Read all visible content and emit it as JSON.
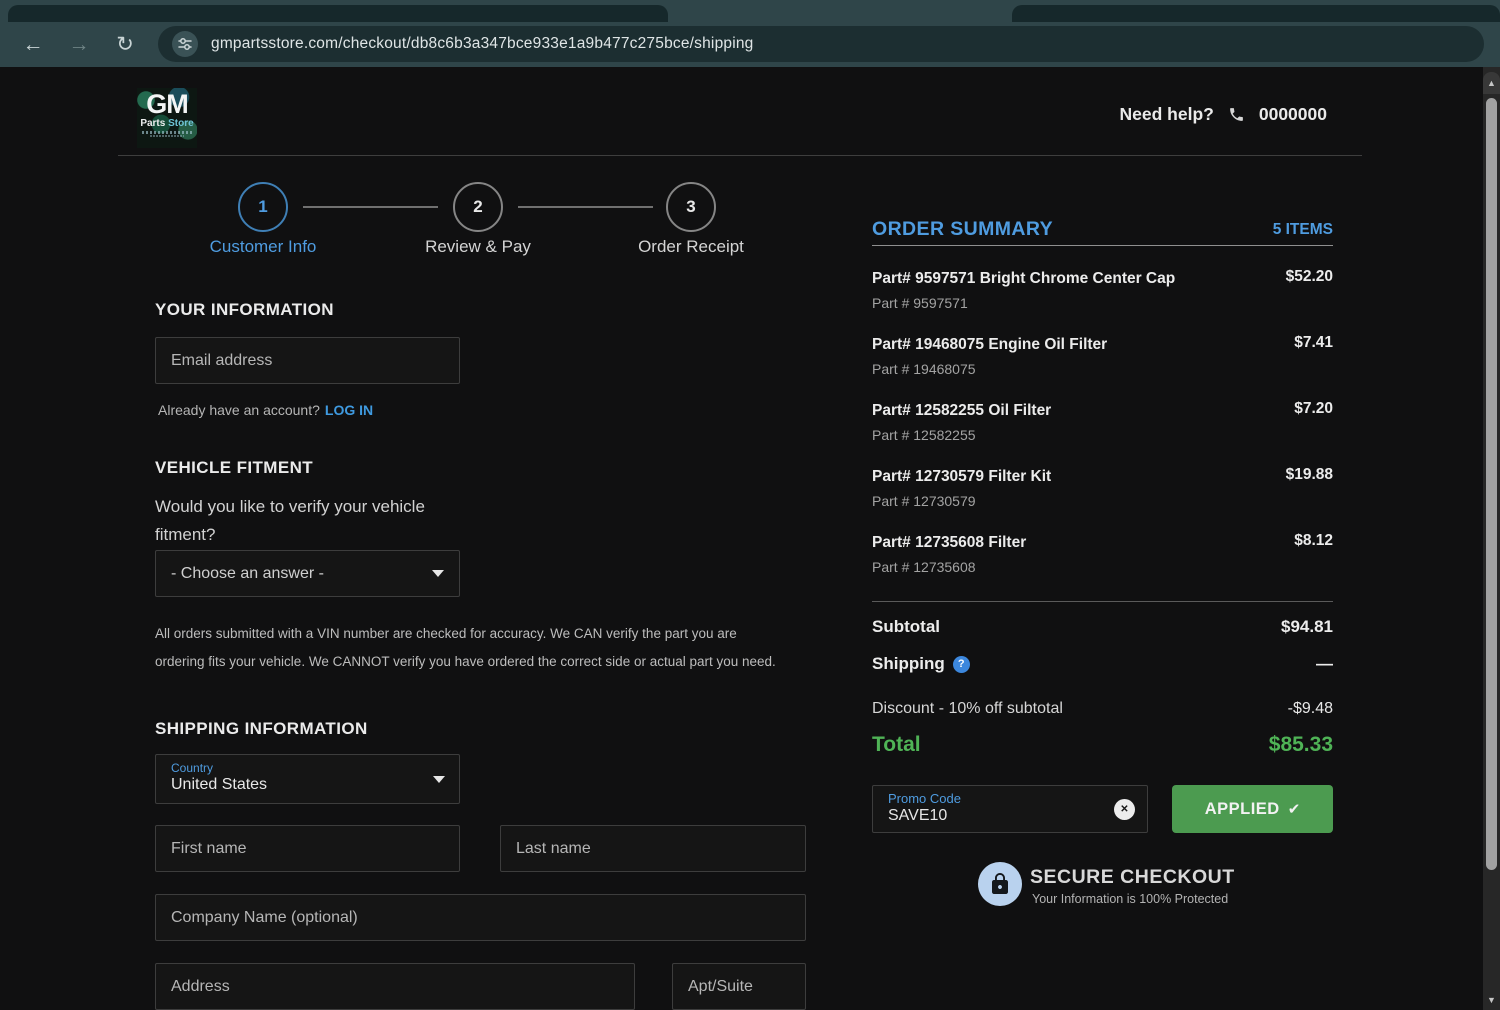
{
  "browser": {
    "url": "gmpartsstore.com/checkout/db8c6b3a347bce933e1a9b477c275bce/shipping"
  },
  "header": {
    "logo_line1": "GM",
    "logo_parts": "Parts",
    "logo_store": "Store",
    "need_help": "Need help?",
    "phone_number": "0000000"
  },
  "stepper": {
    "steps": [
      {
        "number": "1",
        "label": "Customer Info"
      },
      {
        "number": "2",
        "label": "Review & Pay"
      },
      {
        "number": "3",
        "label": "Order Receipt"
      }
    ]
  },
  "your_information": {
    "title": "YOUR INFORMATION",
    "email_placeholder": "Email address",
    "account_prompt": "Already have an account?",
    "login_link": "LOG IN"
  },
  "vehicle_fitment": {
    "title": "VEHICLE FITMENT",
    "question": "Would you like to verify your vehicle fitment?",
    "select_value": "- Choose an answer -",
    "disclaimer": "All orders submitted with a VIN number are checked for accuracy. We CAN verify the part you are ordering fits your vehicle. We CANNOT verify you have ordered the correct side or actual part you need."
  },
  "shipping_information": {
    "title": "SHIPPING INFORMATION",
    "country_label": "Country",
    "country_value": "United States",
    "first_name_placeholder": "First name",
    "last_name_placeholder": "Last name",
    "company_placeholder": "Company Name (optional)",
    "address_placeholder": "Address",
    "apt_placeholder": "Apt/Suite"
  },
  "order_summary": {
    "title": "ORDER SUMMARY",
    "items_count": "5 ITEMS",
    "items": [
      {
        "title": "Part# 9597571 Bright Chrome Center Cap",
        "subtitle": "Part # 9597571",
        "price": "$52.20"
      },
      {
        "title": "Part# 19468075 Engine Oil Filter",
        "subtitle": "Part # 19468075",
        "price": "$7.41"
      },
      {
        "title": "Part# 12582255 Oil Filter",
        "subtitle": "Part # 12582255",
        "price": "$7.20"
      },
      {
        "title": "Part# 12730579 Filter Kit",
        "subtitle": "Part # 12730579",
        "price": "$19.88"
      },
      {
        "title": "Part# 12735608 Filter",
        "subtitle": "Part # 12735608",
        "price": "$8.12"
      }
    ],
    "totals": {
      "subtotal_label": "Subtotal",
      "subtotal_value": "$94.81",
      "shipping_label": "Shipping",
      "shipping_value": "—",
      "discount_label": "Discount - 10% off subtotal",
      "discount_value": "-$9.48",
      "total_label": "Total",
      "total_value": "$85.33"
    },
    "promo": {
      "label": "Promo Code",
      "code": "SAVE10",
      "applied_label": "APPLIED"
    },
    "secure": {
      "title": "SECURE CHECKOUT",
      "subtitle": "Your Information is 100% Protected"
    }
  },
  "icons": {
    "back": "←",
    "forward": "→",
    "reload": "↻",
    "scroll_up": "▲",
    "scroll_down": "▼",
    "check": "✔",
    "clear": "✕",
    "question": "?"
  },
  "colors": {
    "accent_blue": "#4f9ce0",
    "total_green": "#4fb356",
    "applied_green": "#4c9b50",
    "secure_badge_blue": "#b9d2ee",
    "chrome_teal": "#2f4549"
  }
}
